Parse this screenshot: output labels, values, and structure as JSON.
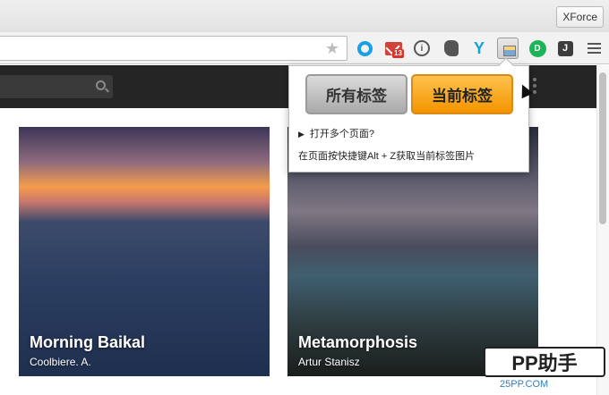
{
  "window": {
    "profile_label": "XForce"
  },
  "toolbar": {
    "mail_badge": "13",
    "info_glyph": "i",
    "y_glyph": "Y",
    "green_glyph": "D",
    "dark_glyph": "J",
    "icons": [
      "star-icon",
      "circle-extension-icon",
      "mail-extension-icon",
      "info-extension-icon",
      "elephant-extension-icon",
      "y-extension-icon",
      "screenshot-extension-icon",
      "green-d-extension-icon",
      "pocket-extension-icon",
      "menu-icon"
    ]
  },
  "popup": {
    "all_tabs_label": "所有标签",
    "current_tab_label": "当前标签",
    "open_multiple": "打开多个页面?",
    "hint": "在页面按快捷键Alt + Z获取当前标签图片"
  },
  "cards": [
    {
      "title": "Morning Baikal",
      "author": "Coolbiere. A."
    },
    {
      "title": "Metamorphosis",
      "author": "Artur Stanisz"
    }
  ],
  "watermark": {
    "brand": "PP助手",
    "url": "25PP.COM"
  }
}
